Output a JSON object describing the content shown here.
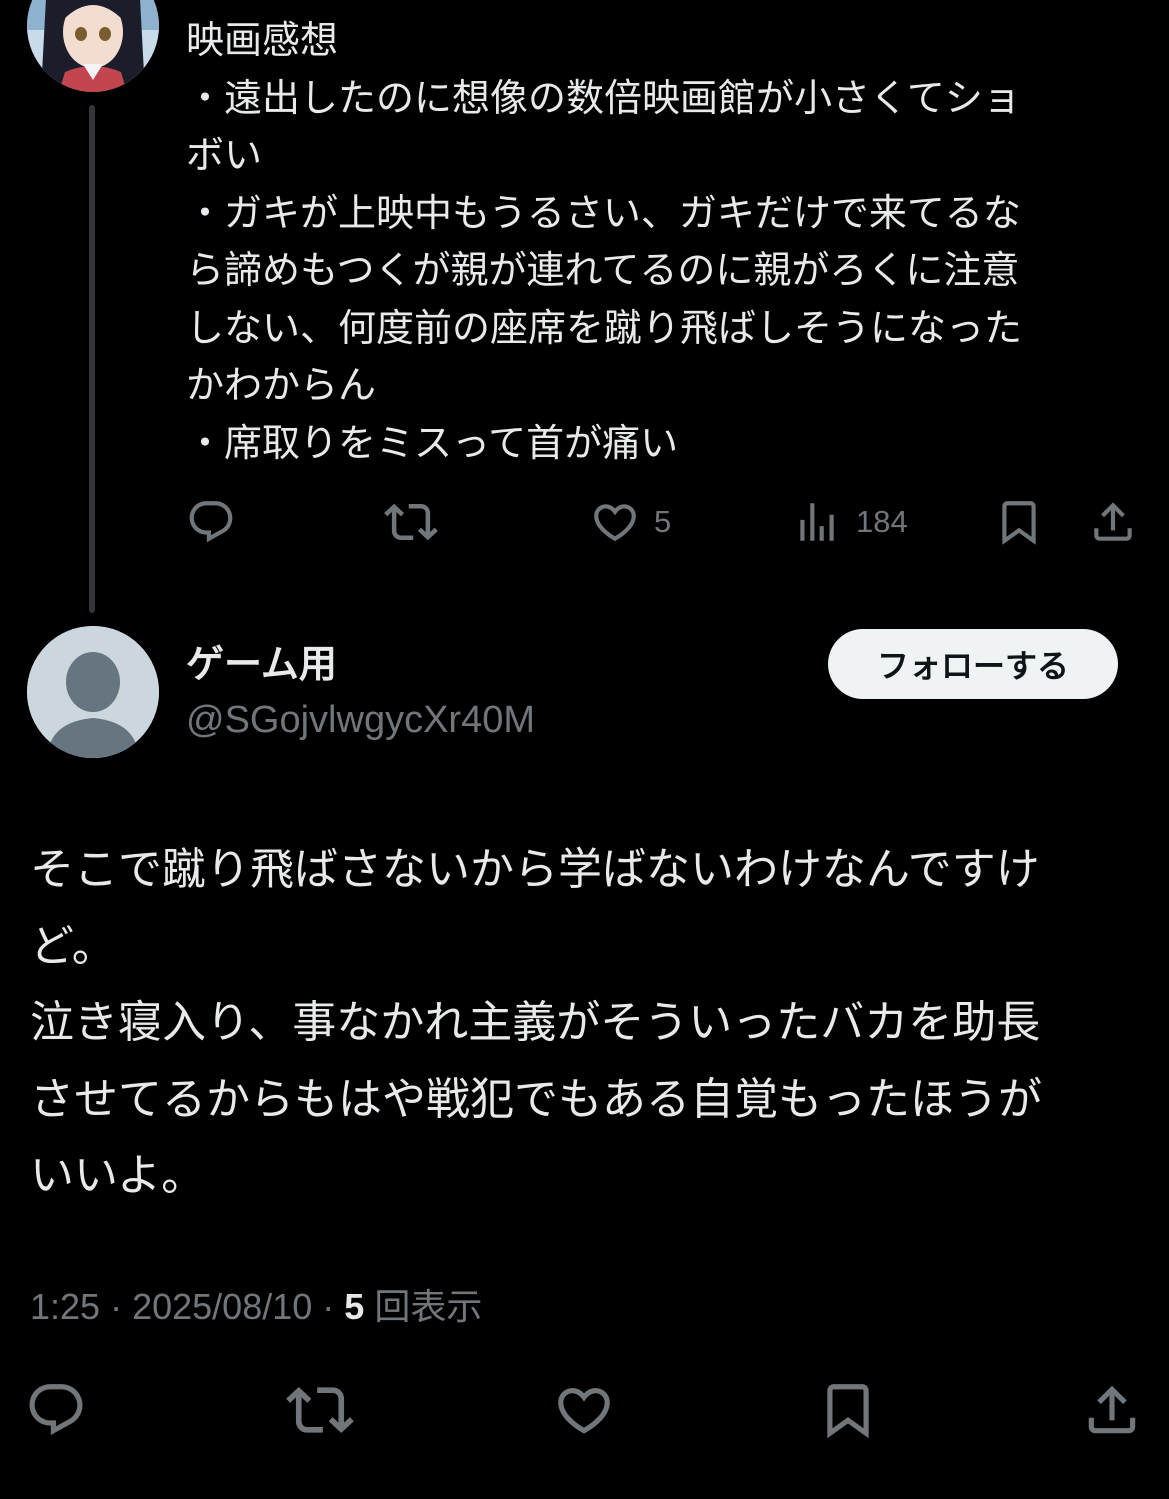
{
  "parent_tweet": {
    "text_lines": [
      "映画感想",
      "・遠出したのに想像の数倍映画館が小さくてショ",
      "ボい",
      "・ガキが上映中もうるさい、ガキだけで来てるな",
      "ら諦めもつくが親が連れてるのに親がろくに注意",
      "しない、何度前の座席を蹴り飛ばしそうになった",
      "かわからん",
      "・席取りをミスって首が痛い"
    ],
    "actions": {
      "reply_icon": "reply-icon",
      "retweet_icon": "retweet-icon",
      "like_icon": "heart-icon",
      "like_count": "5",
      "views_icon": "views-chart-icon",
      "views_count": "184",
      "bookmark_icon": "bookmark-icon",
      "share_icon": "share-icon"
    }
  },
  "reply": {
    "display_name": "ゲーム用",
    "handle": "@SGojvlwgycXr40M",
    "follow_label": "フォローする",
    "text_lines": [
      "そこで蹴り飛ばさないから学ばないわけなんですけ",
      "ど。",
      "泣き寝入り、事なかれ主義がそういったバカを助長",
      "させてるからもはや戦犯でもある自覚もったほうが",
      "いいよ。"
    ],
    "time": "1:25",
    "separator": " · ",
    "date": "2025/08/10",
    "views_count": "5",
    "views_label": "回表示"
  },
  "colors": {
    "background": "#000000",
    "text": "#e7e9ea",
    "muted": "#71767b",
    "follow_button_bg": "#eff3f4",
    "thread_line": "#333639",
    "default_avatar_bg": "#ccd6dd"
  }
}
